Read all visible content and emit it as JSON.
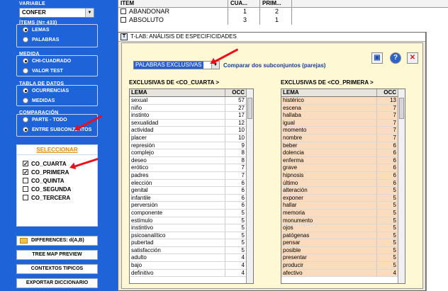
{
  "left_panel": {
    "variable_label": "VARIABLE",
    "variable_value": "CONFER",
    "items_label": "ÍTEMS (N= 433)",
    "items_options": [
      "LEMAS",
      "PALABRAS"
    ],
    "medida_label": "MEDIDA",
    "medida_options": [
      "CHI-CUADRADO",
      "VALOR TEST"
    ],
    "tabla_label": "TABLA DE DATOS",
    "tabla_options": [
      "OCURRENCIAS",
      "MEDIDAS"
    ],
    "comparacion_label": "COMPARACIÓN",
    "comparacion_options": [
      "PARTE - TODO",
      "ENTRE SUBCONJUNTOS"
    ],
    "seleccionar_label": "SELECCIONAR",
    "subsets": [
      {
        "label": "CO_CUARTA",
        "checked": true
      },
      {
        "label": "CO_PRIMERA",
        "checked": true
      },
      {
        "label": "CO_QUINTA",
        "checked": false
      },
      {
        "label": "CO_SEGUNDA",
        "checked": false
      },
      {
        "label": "CO_TERCERA",
        "checked": false
      }
    ],
    "buttons": [
      "DIFFERENCES: d(A,B)",
      "TREE MAP PREVIEW",
      "CONTEXTOS TIPICOS",
      "EXPORTAR DICCIONARIO"
    ]
  },
  "top_table": {
    "headers": [
      "ITEM",
      "CUA...",
      "PRIM..."
    ],
    "rows": [
      [
        "ABANDONAR",
        "1",
        "2"
      ],
      [
        "ABSOLUTO",
        "3",
        "1"
      ]
    ]
  },
  "dialog": {
    "title": "T-LAB: ANÁLISIS DE ESPECIFICIDADES",
    "combo_value": "PALABRAS EXCLUSIVAS",
    "combo_label": "Comparar dos subconjuntos (parejas)",
    "table1_title": "EXCLUSIVAS DE <CO_CUARTA >",
    "table2_title": "EXCLUSIVAS DE <CO_PRIMERA >",
    "col_lema": "LEMA",
    "col_occ": "OCC",
    "table1_rows": [
      [
        "sexual",
        "57"
      ],
      [
        "niño",
        "27"
      ],
      [
        "instinto",
        "17"
      ],
      [
        "sexualidad",
        "12"
      ],
      [
        "actividad",
        "10"
      ],
      [
        "placer",
        "10"
      ],
      [
        "represión",
        "9"
      ],
      [
        "complejo",
        "8"
      ],
      [
        "deseo",
        "8"
      ],
      [
        "erótico",
        "7"
      ],
      [
        "padres",
        "7"
      ],
      [
        "elección",
        "6"
      ],
      [
        "genital",
        "6"
      ],
      [
        "infantile",
        "6"
      ],
      [
        "perversión",
        "6"
      ],
      [
        "componente",
        "5"
      ],
      [
        "estímulo",
        "5"
      ],
      [
        "instintivo",
        "5"
      ],
      [
        "psicoanalítico",
        "5"
      ],
      [
        "pubertad",
        "5"
      ],
      [
        "satisfacción",
        "5"
      ],
      [
        "adulto",
        "4"
      ],
      [
        "bajo",
        "4"
      ],
      [
        "definitivo",
        "4"
      ]
    ],
    "table2_rows": [
      [
        "histérico",
        "13"
      ],
      [
        "escena",
        "7"
      ],
      [
        "hallaba",
        "7"
      ],
      [
        "igual",
        "7"
      ],
      [
        "momento",
        "7"
      ],
      [
        "nombre",
        "7"
      ],
      [
        "beber",
        "6"
      ],
      [
        "dolencia",
        "6"
      ],
      [
        "enferma",
        "6"
      ],
      [
        "grave",
        "6"
      ],
      [
        "hipnosis",
        "6"
      ],
      [
        "último",
        "6"
      ],
      [
        "alteración",
        "5"
      ],
      [
        "exponer",
        "5"
      ],
      [
        "hallar",
        "5"
      ],
      [
        "memoria",
        "5"
      ],
      [
        "monumento",
        "5"
      ],
      [
        "ojos",
        "5"
      ],
      [
        "patógenas",
        "5"
      ],
      [
        "pensar",
        "5"
      ],
      [
        "posible",
        "5"
      ],
      [
        "presentar",
        "5"
      ],
      [
        "producir",
        "5"
      ],
      [
        "afectivo",
        "4"
      ]
    ]
  }
}
